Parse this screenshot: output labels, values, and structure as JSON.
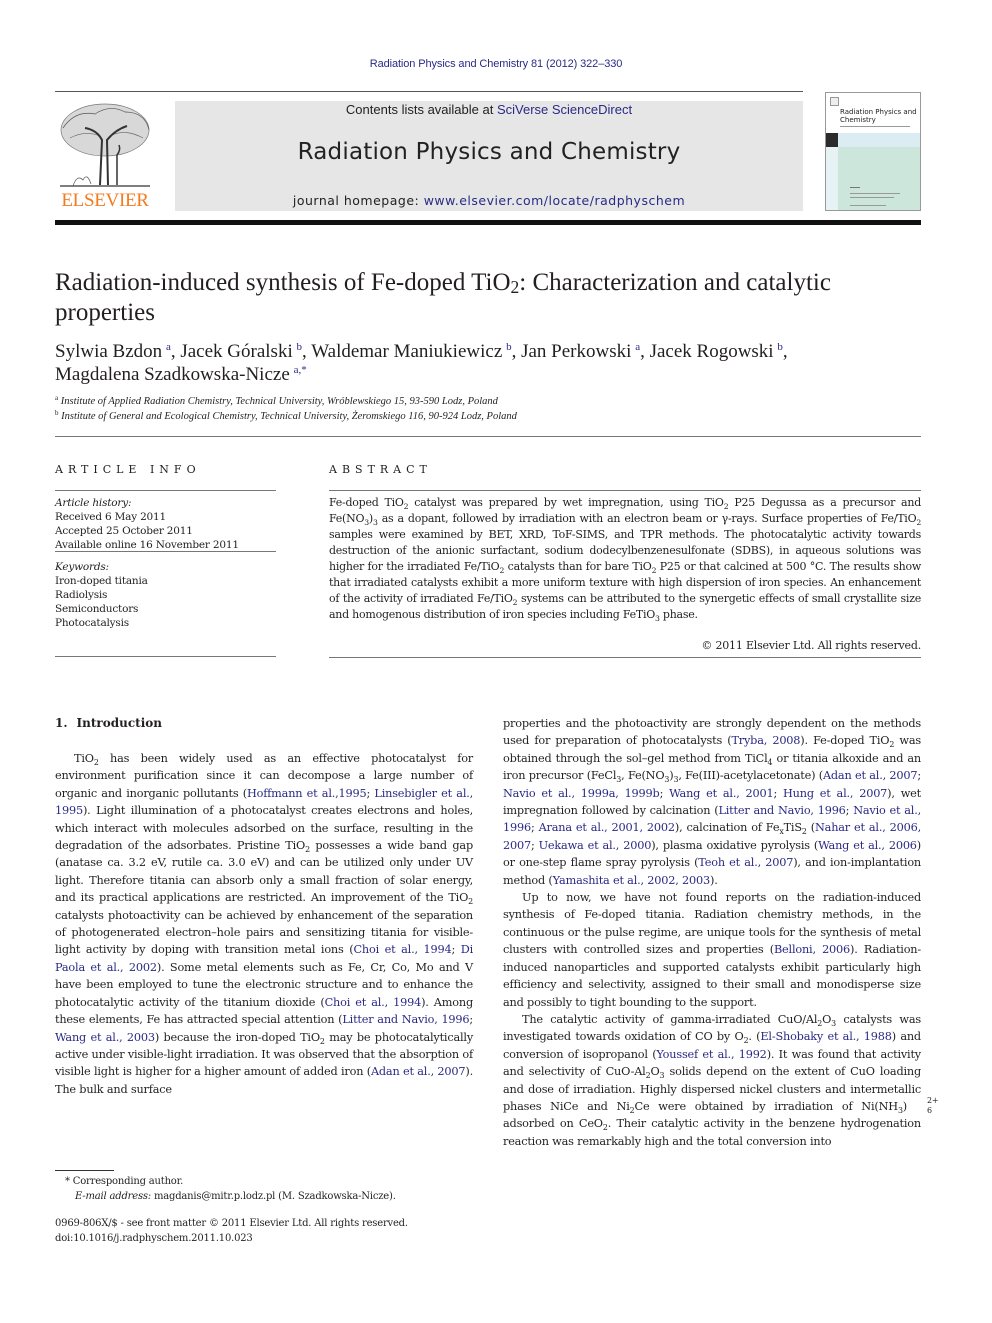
{
  "header": {
    "citation": "Radiation Physics and Chemistry 81 (2012) 322–330",
    "contents_prefix": "Contents lists available at ",
    "contents_link": "SciVerse ScienceDirect",
    "journal_title": "Radiation Physics and Chemistry",
    "homepage_prefix": "journal homepage: ",
    "homepage_link": "www.elsevier.com/locate/radphyschem",
    "publisher_logo_text": "ELSEVIER",
    "cover_title_line1": "Radiation Physics and",
    "cover_title_line2": "Chemistry",
    "colors": {
      "link": "#2a2a86",
      "publisher_orange": "#f47a20",
      "masthead_gray": "#e6e6e6"
    }
  },
  "article": {
    "title_part1": "Radiation-induced synthesis of Fe-doped TiO",
    "title_sub": "2",
    "title_part2": ": Characterization and catalytic properties",
    "authors": [
      {
        "name": "Sylwia Bzdon",
        "aff": "a"
      },
      {
        "name": "Jacek Góralski",
        "aff": "b"
      },
      {
        "name": "Waldemar Maniukiewicz",
        "aff": "b"
      },
      {
        "name": "Jan Perkowski",
        "aff": "a"
      },
      {
        "name": "Jacek Rogowski",
        "aff": "b"
      },
      {
        "name": "Magdalena Szadkowska-Nicze",
        "aff": "a,*"
      }
    ],
    "affiliations": [
      {
        "key": "a",
        "text": "Institute of Applied Radiation Chemistry, Technical University, Wróblewskiego 15, 93-590 Lodz, Poland"
      },
      {
        "key": "b",
        "text": "Institute of General and Ecological Chemistry, Technical University, Żeromskiego 116, 90-924 Lodz, Poland"
      }
    ]
  },
  "article_info": {
    "heading": "ARTICLE INFO",
    "history_label": "Article history:",
    "history": [
      "Received 6 May 2011",
      "Accepted 25 October 2011",
      "Available online 16 November 2011"
    ],
    "keywords_label": "Keywords:",
    "keywords": [
      "Iron-doped titania",
      "Radiolysis",
      "Semiconductors",
      "Photocatalysis"
    ]
  },
  "abstract": {
    "heading": "ABSTRACT",
    "segments": [
      {
        "t": "Fe-doped TiO"
      },
      {
        "sub": "2"
      },
      {
        "t": " catalyst was prepared by wet impregnation, using TiO"
      },
      {
        "sub": "2"
      },
      {
        "t": " P25 Degussa as a precursor and Fe(NO"
      },
      {
        "sub": "3"
      },
      {
        "t": ")"
      },
      {
        "sub": "3"
      },
      {
        "t": " as a dopant, followed by irradiation with an electron beam or γ-rays. Surface properties of Fe/TiO"
      },
      {
        "sub": "2"
      },
      {
        "t": " samples were examined by BET, XRD, ToF-SIMS, and TPR methods. The photocatalytic activity towards destruction of the anionic surfactant, sodium dodecylbenzenesulfonate (SDBS), in aqueous solutions was higher for the irradiated Fe/TiO"
      },
      {
        "sub": "2"
      },
      {
        "t": " catalysts than for bare TiO"
      },
      {
        "sub": "2"
      },
      {
        "t": " P25 or that calcined at 500 °C. The results show that irradiated catalysts exhibit a more uniform texture with high dispersion of iron species. An enhancement of the activity of irradiated Fe/TiO"
      },
      {
        "sub": "2"
      },
      {
        "t": " systems can be attributed to the synergetic effects of small crystallite size and homogenous distribution of iron species including FeTiO"
      },
      {
        "sub": "3"
      },
      {
        "t": " phase."
      }
    ],
    "copyright": "© 2011 Elsevier Ltd. All rights reserved."
  },
  "introduction": {
    "number": "1.",
    "heading": "Introduction",
    "left_paragraphs": [
      [
        {
          "t": "TiO"
        },
        {
          "sub": "2"
        },
        {
          "t": " has been widely used as an effective photocatalyst for environment purification since it can decompose a large number of organic and inorganic pollutants ("
        },
        {
          "link": "Hoffmann et al.,1995"
        },
        {
          "t": "; "
        },
        {
          "link": "Linsebigler et al., 1995"
        },
        {
          "t": "). Light illumination of a photocatalyst creates electrons and holes, which interact with molecules adsorbed on the surface, resulting in the degradation of the adsorbates. Pristine TiO"
        },
        {
          "sub": "2"
        },
        {
          "t": " possesses a wide band gap (anatase ca. 3.2 eV, rutile ca. 3.0 eV) and can be utilized only under UV light. Therefore titania can absorb only a small fraction of solar energy, and its practical applications are restricted. An improvement of the TiO"
        },
        {
          "sub": "2"
        },
        {
          "t": " catalysts photoactivity can be achieved by enhancement of the separation of photogenerated electron–hole pairs and sensitizing titania for visible-light activity by doping with transition metal ions ("
        },
        {
          "link": "Choi et al., 1994"
        },
        {
          "t": "; "
        },
        {
          "link": "Di Paola et al., 2002"
        },
        {
          "t": "). Some metal elements such as Fe, Cr, Co, Mo and V have been employed to tune the electronic structure and to enhance the photocatalytic activity of the titanium dioxide ("
        },
        {
          "link": "Choi et al., 1994"
        },
        {
          "t": "). Among these elements, Fe has attracted special attention ("
        },
        {
          "link": "Litter and Navio, 1996"
        },
        {
          "t": "; "
        },
        {
          "link": "Wang et al., 2003"
        },
        {
          "t": ") because the iron-doped TiO"
        },
        {
          "sub": "2"
        },
        {
          "t": " may be photocatalytically active under visible-light irradiation. It was observed that the absorption of visible light is higher for a higher amount of added iron ("
        },
        {
          "link": "Adan et al., 2007"
        },
        {
          "t": "). The bulk and surface"
        }
      ]
    ],
    "right_paragraphs": [
      [
        {
          "t": "properties and the photoactivity are strongly dependent on the methods used for preparation of photocatalysts ("
        },
        {
          "link": "Tryba, 2008"
        },
        {
          "t": "). Fe-doped TiO"
        },
        {
          "sub": "2"
        },
        {
          "t": " was obtained through the sol–gel method from TiCl"
        },
        {
          "sub": "4"
        },
        {
          "t": " or titania alkoxide and an iron precursor (FeCl"
        },
        {
          "sub": "3"
        },
        {
          "t": ", Fe(NO"
        },
        {
          "sub": "3"
        },
        {
          "t": ")"
        },
        {
          "sub": "3"
        },
        {
          "t": ", Fe(III)-acetylacetonate) ("
        },
        {
          "link": "Adan et al., 2007"
        },
        {
          "t": "; "
        },
        {
          "link": "Navio et al., 1999a, 1999b"
        },
        {
          "t": "; "
        },
        {
          "link": "Wang et al., 2001"
        },
        {
          "t": "; "
        },
        {
          "link": "Hung et al., 2007"
        },
        {
          "t": "), wet impregnation followed by calcination ("
        },
        {
          "link": "Litter and Navio, 1996"
        },
        {
          "t": "; "
        },
        {
          "link": "Navio et al., 1996"
        },
        {
          "t": "; "
        },
        {
          "link": "Arana et al., 2001, 2002"
        },
        {
          "t": "), calcination of Fe"
        },
        {
          "sub": "x"
        },
        {
          "t": "TiS"
        },
        {
          "sub": "2"
        },
        {
          "t": " ("
        },
        {
          "link": "Nahar et al., 2006, 2007"
        },
        {
          "t": "; "
        },
        {
          "link": "Uekawa et al., 2000"
        },
        {
          "t": "), plasma oxidative pyrolysis ("
        },
        {
          "link": "Wang et al., 2006"
        },
        {
          "t": ") or one-step flame spray pyrolysis ("
        },
        {
          "link": "Teoh et al., 2007"
        },
        {
          "t": "), and ion-implantation method ("
        },
        {
          "link": "Yamashita et al., 2002, 2003"
        },
        {
          "t": ")."
        }
      ],
      [
        {
          "t": "Up to now, we have not found reports on the radiation-induced synthesis of Fe-doped titania. Radiation chemistry methods, in the continuous or the pulse regime, are unique tools for the synthesis of metal clusters with controlled sizes and properties ("
        },
        {
          "link": "Belloni, 2006"
        },
        {
          "t": "). Radiation-induced nanoparticles and supported catalysts exhibit particularly high efficiency and selectivity, assigned to their small and monodisperse size and possibly to tight bounding to the support."
        }
      ],
      [
        {
          "t": "The catalytic activity of gamma-irradiated CuO/Al"
        },
        {
          "sub": "2"
        },
        {
          "t": "O"
        },
        {
          "sub": "3"
        },
        {
          "t": " catalysts was investigated towards oxidation of CO by O"
        },
        {
          "sub": "2"
        },
        {
          "t": ". ("
        },
        {
          "link": "El-Shobaky et al., 1988"
        },
        {
          "t": ") and conversion of isopropanol ("
        },
        {
          "link": "Youssef et al., 1992"
        },
        {
          "t": "). It was found that activity and selectivity of CuO-Al"
        },
        {
          "sub": "2"
        },
        {
          "t": "O"
        },
        {
          "sub": "3"
        },
        {
          "t": " solids depend on the extent of CuO loading and dose of irradiation. Highly dispersed nickel clusters and intermetallic phases NiCe and Ni"
        },
        {
          "sub": "2"
        },
        {
          "t": "Ce were obtained by irradiation of Ni(NH"
        },
        {
          "sub": "3"
        },
        {
          "t": ")"
        },
        {
          "supsub": [
            "2+",
            "6"
          ]
        },
        {
          "t": " adsorbed on CeO"
        },
        {
          "sub": "2"
        },
        {
          "t": ". Their catalytic activity in the benzene hydrogenation reaction was remarkably high and the total conversion into"
        }
      ]
    ]
  },
  "footnotes": {
    "corresponding": "* Corresponding author.",
    "email_label": "E-mail address:",
    "email_value": "magdanis@mitr.p.lodz.pl (M. Szadkowska-Nicze).",
    "front_matter": "0969-806X/$ - see front matter © 2011 Elsevier Ltd. All rights reserved.",
    "doi": "doi:10.1016/j.radphyschem.2011.10.023"
  }
}
